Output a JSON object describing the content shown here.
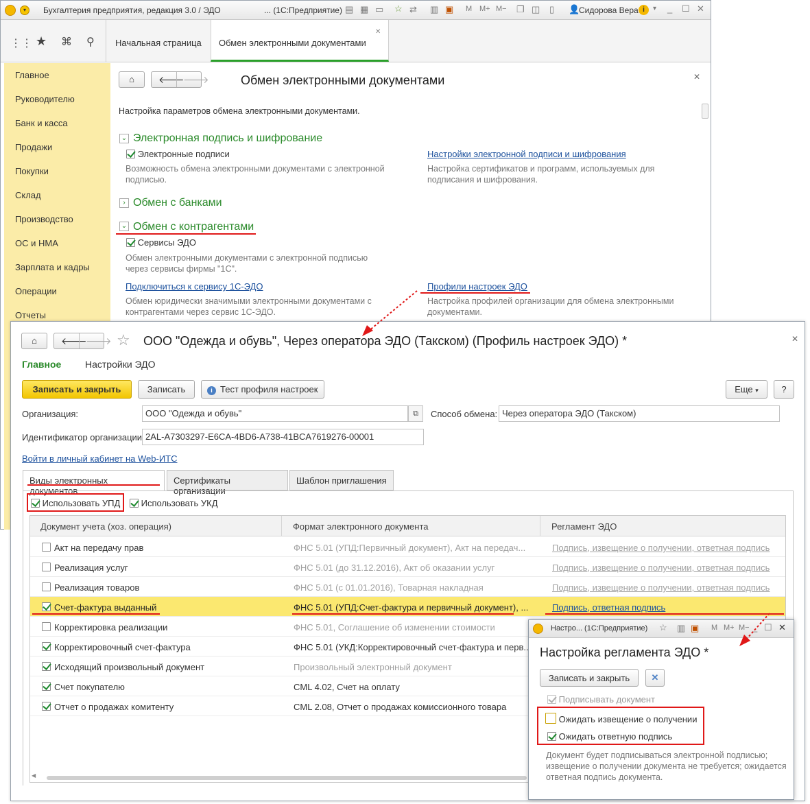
{
  "main_window": {
    "title": "Бухгалтерия предприятия, редакция 3.0 / ЭДО",
    "title_suffix": "... (1С:Предприятие)",
    "user": "Сидорова Вера",
    "tabs": [
      "Начальная страница",
      "Обмен электронными документами"
    ],
    "sidebar": [
      "Главное",
      "Руководителю",
      "Банк и касса",
      "Продажи",
      "Покупки",
      "Склад",
      "Производство",
      "ОС и НМА",
      "Зарплата и кадры",
      "Операции",
      "Отчеты"
    ],
    "form_title": "Обмен электронными документами",
    "intro": "Настройка параметров обмена электронными документами.",
    "sec_signature": "Электронная подпись и шифрование",
    "signatures_label": "Электронные подписи",
    "signatures_desc": "Возможность обмена электронными документами с электронной подписью.",
    "signature_settings_link": "Настройки электронной подписи и шифрования",
    "signature_settings_desc": "Настройка сертификатов и программ, используемых для подписания и шифрования.",
    "sec_banks": "Обмен с банками",
    "sec_contractors": "Обмен с контрагентами",
    "edo_services_label": "Сервисы ЭДО",
    "edo_services_desc": "Обмен электронными документами с электронной подписью через сервисы фирмы \"1С\".",
    "connect_link": "Подключиться к сервису 1С-ЭДО",
    "connect_desc": "Обмен юридически значимыми электронными документами с контрагентами через сервис 1С-ЭДО.",
    "profiles_link": "Профили настроек ЭДО",
    "profiles_desc": "Настройка профилей организации для обмена электронными документами."
  },
  "profile_window": {
    "title": "ООО \"Одежда и обувь\", Через оператора ЭДО (Такском) (Профиль настроек ЭДО) *",
    "nav_main": "Главное",
    "nav_settings": "Настройки ЭДО",
    "btn_save_close": "Записать и закрыть",
    "btn_save": "Записать",
    "btn_test": "Тест профиля настроек",
    "btn_more": "Еще",
    "btn_help": "?",
    "org_label": "Организация:",
    "org_value": "ООО \"Одежда и обувь\"",
    "method_label": "Способ обмена:",
    "method_value": "Через оператора ЭДО (Такском)",
    "org_id_label": "Идентификатор организации:",
    "org_id_value": "2AL-A7303297-E6CA-4BD6-A738-41BCA7619276-00001",
    "webits_link": "Войти в личный кабинет на Web-ИТС",
    "tabs": [
      "Виды электронных документов",
      "Сертификаты организации",
      "Шаблон приглашения"
    ],
    "use_upd": "Использовать УПД",
    "use_ukd": "Использовать УКД",
    "columns": [
      "Документ учета (хоз. операция)",
      "Формат электронного документа",
      "Регламент ЭДО"
    ],
    "rows": [
      {
        "doc": "Акт на передачу прав",
        "checked": false,
        "format": "ФНС 5.01 (УПД:Первичный документ), Акт на передач...",
        "reg": "Подпись, извещение о получении, ответная подпись"
      },
      {
        "doc": "Реализация услуг",
        "checked": false,
        "format": "ФНС 5.01 (до 31.12.2016), Акт об оказании услуг",
        "reg": "Подпись, извещение о получении, ответная подпись"
      },
      {
        "doc": "Реализация товаров",
        "checked": false,
        "format": "ФНС 5.01 (с 01.01.2016), Товарная накладная",
        "reg": "Подпись, извещение о получении, ответная подпись"
      },
      {
        "doc": "Счет-фактура выданный",
        "checked": true,
        "format": "ФНС 5.01 (УПД:Счет-фактура и первичный документ), ...",
        "reg": "Подпись, ответная подпись"
      },
      {
        "doc": "Корректировка реализации",
        "checked": false,
        "format": "ФНС 5.01, Соглашение об изменении стоимости",
        "reg": ""
      },
      {
        "doc": "Корректировочный счет-фактура",
        "checked": true,
        "format": "ФНС 5.01 (УКД:Корректировочный счет-фактура и перв...",
        "reg": ""
      },
      {
        "doc": "Исходящий произвольный документ",
        "checked": true,
        "format": "Произвольный электронный документ",
        "reg": ""
      },
      {
        "doc": "Счет покупателю",
        "checked": true,
        "format": "CML 4.02, Счет на оплату",
        "reg": ""
      },
      {
        "doc": "Отчет о продажах комитенту",
        "checked": true,
        "format": "CML 2.08, Отчет о продажах комиссионного товара",
        "reg": ""
      }
    ]
  },
  "reglament_window": {
    "title": "Настро... (1С:Предприятие)",
    "heading": "Настройка регламента ЭДО *",
    "btn_save_close": "Записать и закрыть",
    "sign_doc": "Подписывать документ",
    "wait_notice": "Ожидать извещение о получении",
    "wait_reply": "Ожидать ответную подпись",
    "note": "Документ будет подписываться электронной подписью; извещение о получении документа не требуется; ожидается ответная подпись документа."
  },
  "colors": {
    "accent_green": "#2a8a2a",
    "highlight_yellow": "#fbe870",
    "sidebar": "#fbeca8",
    "annotation_red": "#e01818",
    "link": "#1a4f9c"
  }
}
